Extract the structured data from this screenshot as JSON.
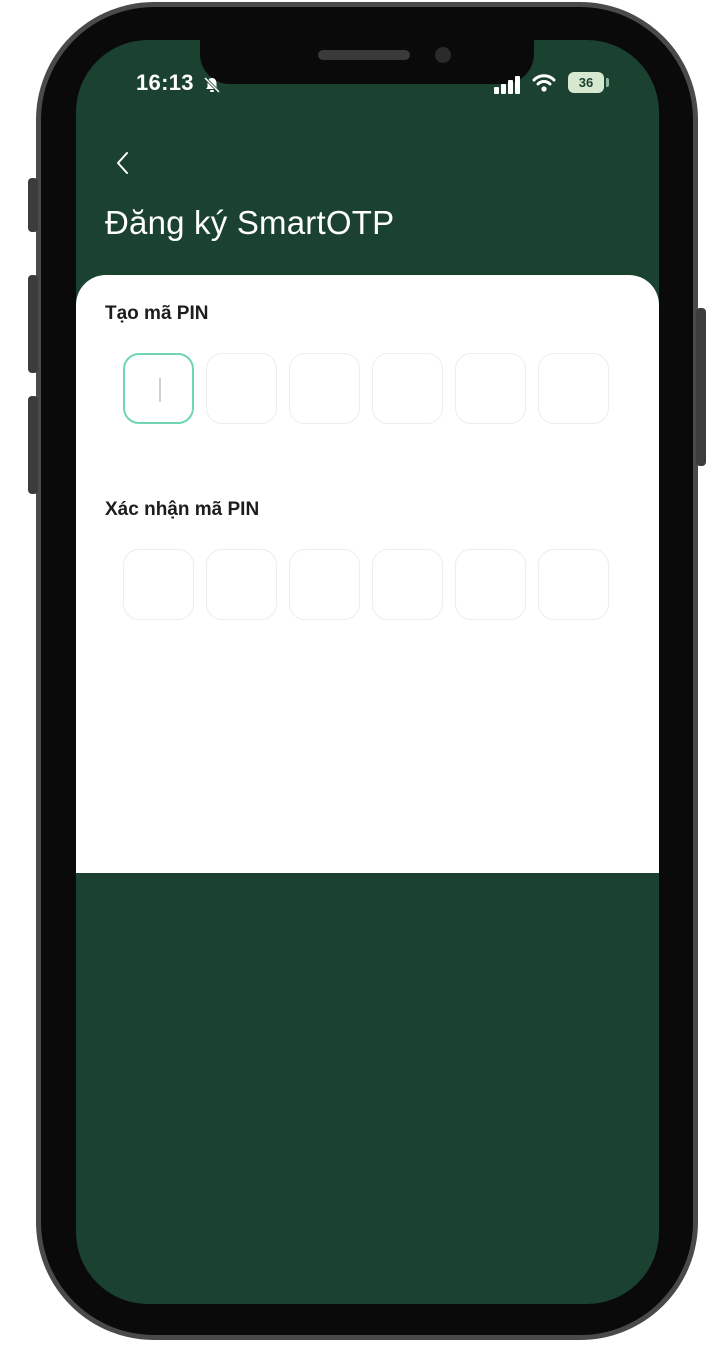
{
  "status_bar": {
    "time": "16:13",
    "battery_level": "36",
    "icons": [
      "bell-off-icon",
      "signal-icon",
      "wifi-icon",
      "battery-icon"
    ]
  },
  "header": {
    "back_icon": "chevron-left-icon",
    "title": "Đăng ký SmartOTP"
  },
  "form": {
    "create_pin_label": "Tạo mã PIN",
    "confirm_pin_label": "Xác nhận mã PIN",
    "pin_length": 6,
    "active_field": "create_pin",
    "active_digit_index": 0
  },
  "colors": {
    "brand_green": "#1b4130",
    "active_border": "#6fd6b0",
    "inactive_border": "#ededed",
    "card_background": "#ffffff"
  }
}
